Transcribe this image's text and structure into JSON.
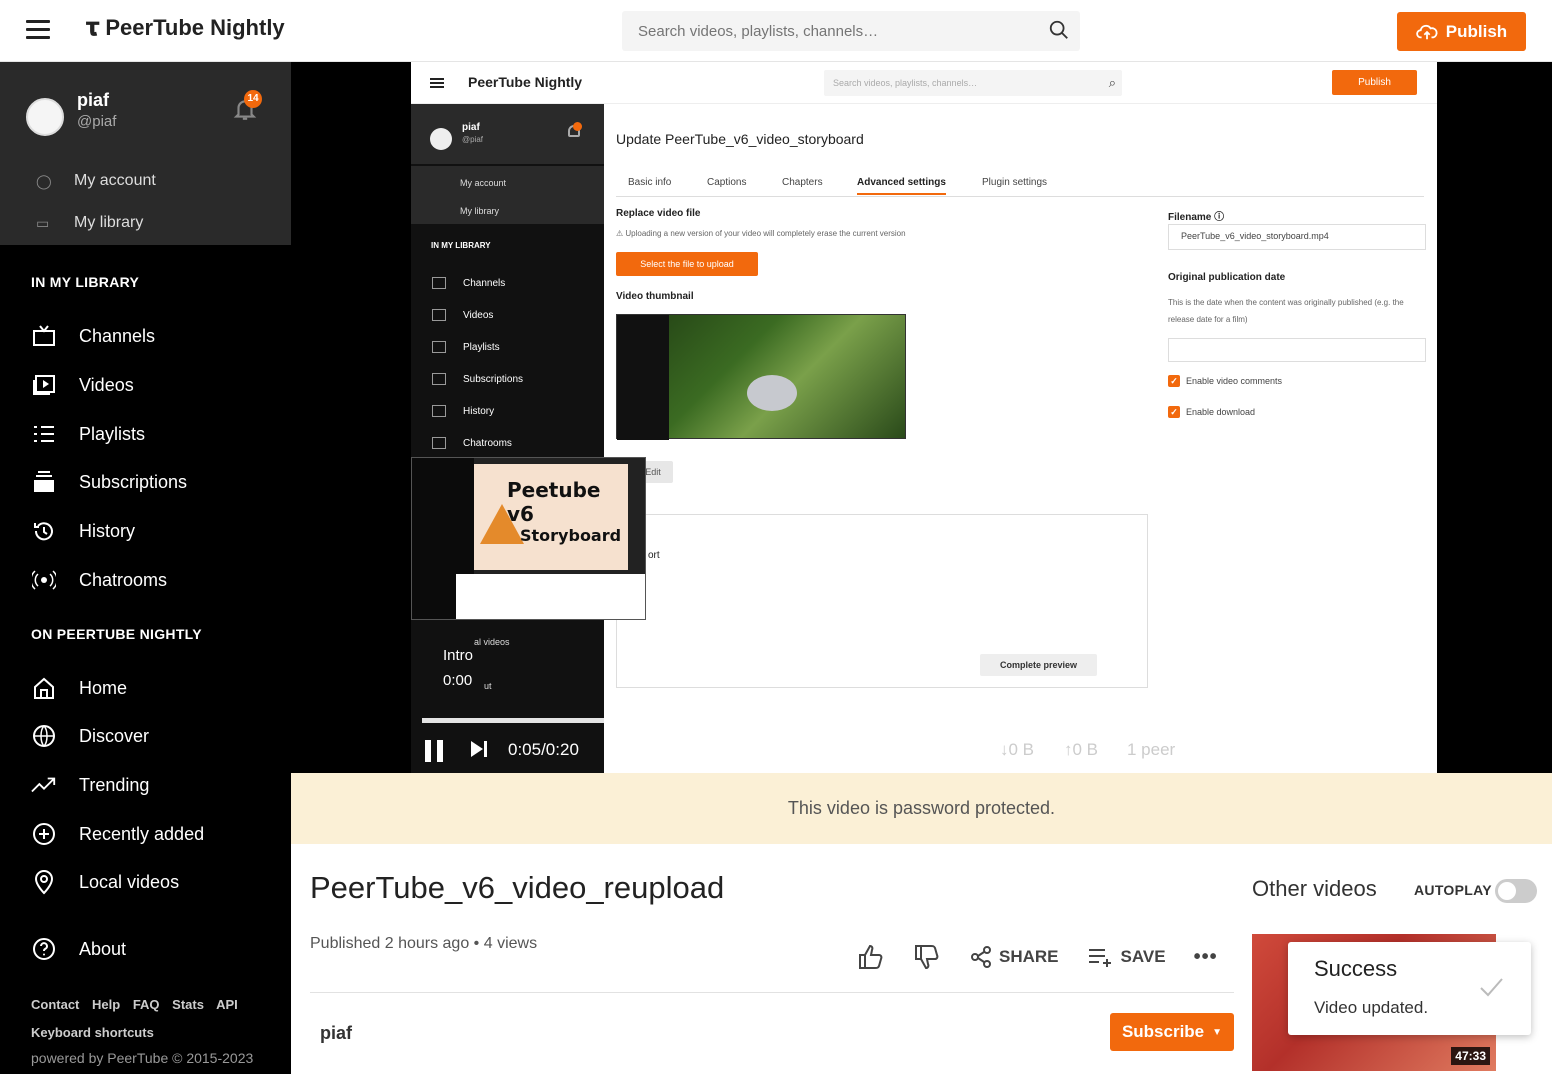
{
  "header": {
    "app_name": "PeerTube Nightly",
    "search_placeholder": "Search videos, playlists, channels…",
    "publish_label": "Publish"
  },
  "sidebar": {
    "user": {
      "name": "piaf",
      "handle": "@piaf",
      "notifications": "14"
    },
    "account_items": [
      {
        "label": "My account",
        "icon": "user-icon"
      },
      {
        "label": "My library",
        "icon": "library-icon"
      }
    ],
    "library_section": "IN MY LIBRARY",
    "library_items": [
      {
        "label": "Channels",
        "icon": "channels-icon"
      },
      {
        "label": "Videos",
        "icon": "videos-icon"
      },
      {
        "label": "Playlists",
        "icon": "playlists-icon"
      },
      {
        "label": "Subscriptions",
        "icon": "subscriptions-icon"
      },
      {
        "label": "History",
        "icon": "history-icon"
      },
      {
        "label": "Chatrooms",
        "icon": "chatrooms-icon"
      }
    ],
    "site_section": "ON PEERTUBE NIGHTLY",
    "site_items": [
      {
        "label": "Home",
        "icon": "home-icon"
      },
      {
        "label": "Discover",
        "icon": "globe-icon"
      },
      {
        "label": "Trending",
        "icon": "trending-icon"
      },
      {
        "label": "Recently added",
        "icon": "plus-circle-icon"
      },
      {
        "label": "Local videos",
        "icon": "location-icon"
      }
    ],
    "about_label": "About",
    "footer_links": [
      "Contact",
      "Help",
      "FAQ",
      "Stats",
      "API"
    ],
    "keyboard_shortcuts": "Keyboard shortcuts",
    "powered_by": "powered by PeerTube © 2015-2023"
  },
  "player_frame": {
    "app_name": "PeerTube Nightly",
    "search_placeholder": "Search videos, playlists, channels…",
    "publish_label": "Publish",
    "user_name": "piaf",
    "user_handle": "@piaf",
    "my_account": "My account",
    "my_library": "My library",
    "library_section": "IN MY LIBRARY",
    "nav": [
      "Channels",
      "Videos",
      "Playlists",
      "Subscriptions",
      "History",
      "Chatrooms"
    ],
    "local_videos_partial": "al videos",
    "about_partial": "ut",
    "page_title": "Update PeerTube_v6_video_storyboard",
    "tabs": [
      "Basic info",
      "Captions",
      "Chapters",
      "Advanced settings",
      "Plugin settings"
    ],
    "active_tab": "Advanced settings",
    "replace_label": "Replace video file",
    "replace_note": "Uploading a new version of your video will completely erase the current version",
    "select_file_btn": "Select the file to upload",
    "thumbnail_label": "Video thumbnail",
    "edit_label": "Edit",
    "support_partial": "ort",
    "complete_preview": "Complete preview",
    "filename_label": "Filename",
    "filename_value": "PeerTube_v6_video_storyboard.mp4",
    "pubdate_label": "Original publication date",
    "pubdate_note": "This is the date when the content was originally published (e.g. the release date for a film)",
    "enable_comments": "Enable video comments",
    "enable_download": "Enable download",
    "storyboard_title": "Peetube v6",
    "storyboard_subtitle": "Storyboard"
  },
  "player": {
    "chapter": "Intro",
    "chapter_time": "0:00",
    "time": "0:05/0:20",
    "download": "0 B",
    "upload": "0 B",
    "peers": "1 peer",
    "progress_fraction": 0.25
  },
  "banner": "This video is password protected.",
  "video": {
    "title": "PeerTube_v6_video_reupload",
    "meta": "Published 2 hours ago • 4 views",
    "share_label": "SHARE",
    "save_label": "SAVE",
    "channel": "piaf",
    "subscribe_label": "Subscribe"
  },
  "other_videos": {
    "title": "Other videos",
    "autoplay_label": "AUTOPLAY",
    "autoplay_on": false,
    "duration": "47:33"
  },
  "toast": {
    "title": "Success",
    "message": "Video updated."
  },
  "colors": {
    "accent": "#f2690d",
    "banner_bg": "#fbf0d6"
  }
}
